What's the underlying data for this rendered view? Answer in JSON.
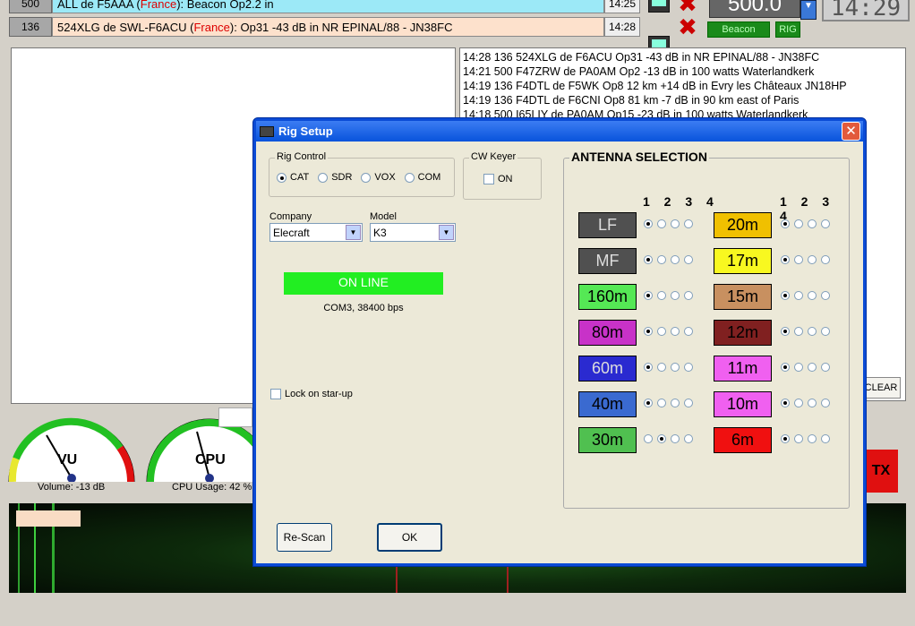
{
  "messages": [
    {
      "id": "500",
      "text_pre": "ALL de F5AAA (",
      "country": "France",
      "text_post": "): Beacon Op2.2 in",
      "time": "14:25"
    },
    {
      "id": "136",
      "text_pre": "524XLG de SWL-F6ACU (",
      "country": "France",
      "text_post": "): Op31  -43 dB in NR EPINAL/88 - JN38FC",
      "time": "14:28"
    }
  ],
  "frequency": "500.0",
  "clock": "14:29",
  "beacon_label": "Beacon",
  "rig_label": "RIG",
  "log_lines": [
    "14:28 136 524XLG de F6ACU Op31  -43 dB in NR EPINAL/88 - JN38FC",
    "14:21 500 F47ZRW de PA0AM Op2  -13 dB in 100 watts Waterlandkerk",
    "14:19 136 F4DTL de F5WK Op8 12 km +14 dB in Evry les Châteaux JN18HP",
    "14:19 136 F4DTL de F6CNI Op8 81 km -7 dB in 90 km east of Paris",
    "14:18 500 I65LIY de PA0AM Op15  -23 dB in 100 watts Waterlandkerk"
  ],
  "clear_label": "CLEAR",
  "tx_label": "TX",
  "vu": {
    "label": "VU",
    "caption": "Volume: -13 dB"
  },
  "cpu": {
    "label": "CPU",
    "caption": "CPU Usage: 42 %"
  },
  "dialog": {
    "title": "Rig Setup",
    "rig_control": {
      "legend": "Rig Control",
      "options": [
        "CAT",
        "SDR",
        "VOX",
        "COM"
      ],
      "selected": "CAT"
    },
    "cw_keyer": {
      "legend": "CW Keyer",
      "label": "ON",
      "checked": false
    },
    "company": {
      "label": "Company",
      "value": "Elecraft"
    },
    "model": {
      "label": "Model",
      "value": "K3"
    },
    "status": "ON LINE",
    "port_info": "COM3, 38400 bps",
    "lock_label": "Lock on star-up",
    "rescan_label": "Re-Scan",
    "ok_label": "OK",
    "antenna": {
      "legend": "ANTENNA SELECTION",
      "col_numbers": "1 2 3 4",
      "left": [
        {
          "band": "LF",
          "color": "#505050",
          "selected": 1
        },
        {
          "band": "MF",
          "color": "#505050",
          "selected": 1
        },
        {
          "band": "160m",
          "color": "#55e855",
          "selected": 1
        },
        {
          "band": "80m",
          "color": "#c832c8",
          "selected": 1
        },
        {
          "band": "60m",
          "color": "#2a2ad0",
          "selected": 1
        },
        {
          "band": "40m",
          "color": "#3a6ad0",
          "selected": 1
        },
        {
          "band": "30m",
          "color": "#50c050",
          "selected": 2
        }
      ],
      "right": [
        {
          "band": "20m",
          "color": "#f0c000",
          "selected": 1
        },
        {
          "band": "17m",
          "color": "#f8f820",
          "selected": 1
        },
        {
          "band": "15m",
          "color": "#c89060",
          "selected": 1
        },
        {
          "band": "12m",
          "color": "#802020",
          "selected": 1
        },
        {
          "band": "11m",
          "color": "#f060f0",
          "selected": 1
        },
        {
          "band": "10m",
          "color": "#f060f0",
          "selected": 1
        },
        {
          "band": "6m",
          "color": "#f01010",
          "selected": 1
        }
      ]
    }
  }
}
